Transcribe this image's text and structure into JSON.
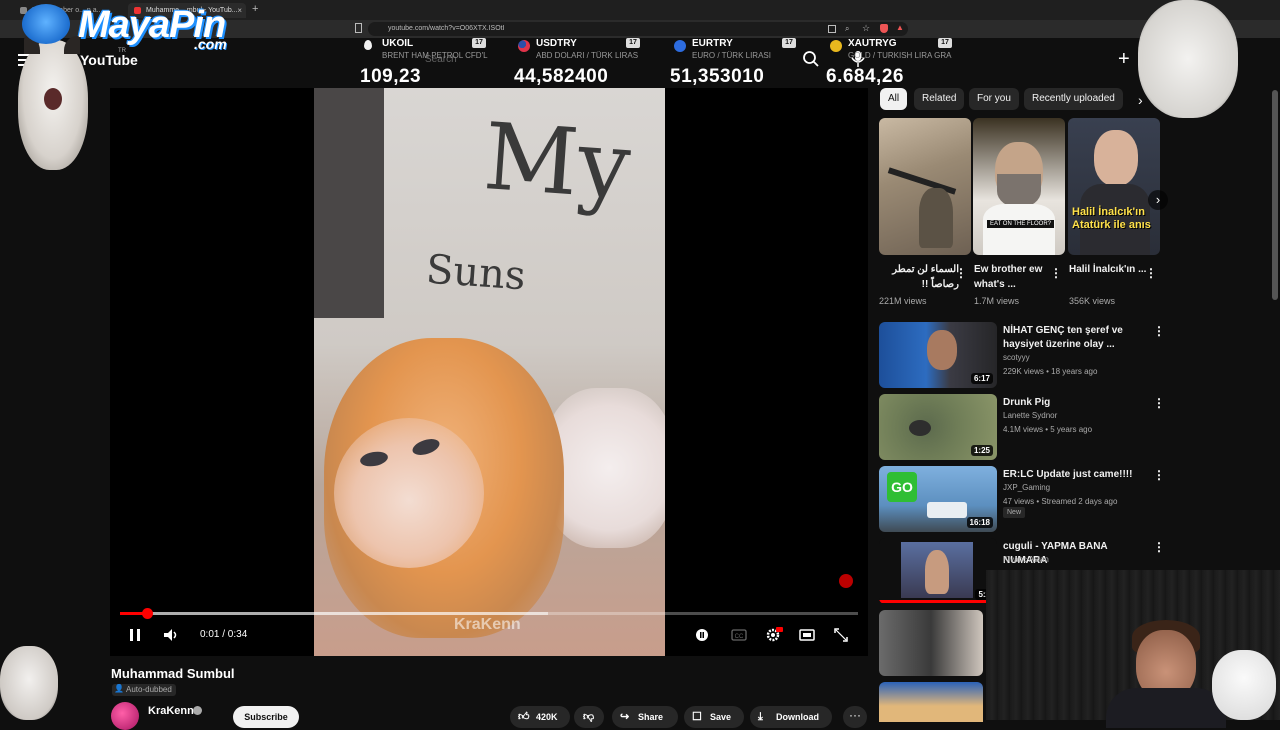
{
  "browser": {
    "tabs": [
      {
        "label": "Mu... 3 haber o... n a...",
        "active": false
      },
      {
        "label": "Muhamme... mbul - YouTub...",
        "active": true
      }
    ],
    "url": "youtube.com/watch?v=O06XTX.ISOtI"
  },
  "overlay_logo": {
    "text": "MayaPin",
    "sub": ".com"
  },
  "youtube": {
    "wordmark": "YouTube",
    "region": "TR",
    "search_placeholder": "Search"
  },
  "ticker": [
    {
      "symbol": "UKOIL",
      "desc": "BRENT HAM PETROL CFD'L",
      "value": "109,23",
      "color": "#f2f2f2"
    },
    {
      "symbol": "USDTRY",
      "desc": "ABD DOLARI / TÜRK LIRAS",
      "value": "44,582400",
      "color": "#e0334a"
    },
    {
      "symbol": "EURTRY",
      "desc": "EURO / TÜRK LIRASI",
      "value": "51,353010",
      "color": "#2d6cdf"
    },
    {
      "symbol": "XAUTRYG",
      "desc": "GOLD / TURKISH LIRA GRA",
      "value": "6.684,26",
      "color": "#e8b81e"
    }
  ],
  "player": {
    "shirt_text_1": "My",
    "shirt_text_2": "Suns",
    "watermark": "KraKenn",
    "time": "0:01 / 0:34",
    "progress_fraction": 0.037,
    "buffer_fraction": 0.58
  },
  "video": {
    "title": "Muhammad Sumbul",
    "auto_dubbed": "Auto-dubbed",
    "channel": "KraKenn",
    "subscribe": "Subscribe",
    "likes": "420K",
    "share": "Share",
    "save": "Save",
    "download": "Download"
  },
  "chips": [
    "All",
    "Related",
    "For you",
    "Recently uploaded"
  ],
  "shorts": [
    {
      "title": "السماء لن تمطر رصاصاً !!",
      "views": "221M views",
      "overlay": ""
    },
    {
      "title": "Ew brother ew what's ...",
      "views": "1.7M views",
      "overlay": "EAT ON THE FLOOR?"
    },
    {
      "title": "Halil İnalcık'ın ...",
      "views": "356K views",
      "overlay": "Halil İnalcık'ın Atatürk ile anıs"
    }
  ],
  "recommendations": [
    {
      "title": "NİHAT GENÇ ten şeref ve haysiyet üzerine olay ...",
      "channel": "scotyyy",
      "meta": "229K views • 18 years ago",
      "duration": "6:17",
      "badge": ""
    },
    {
      "title": "Drunk Pig",
      "channel": "Lanette Sydnor",
      "meta": "4.1M views • 5 years ago",
      "duration": "1:25",
      "badge": ""
    },
    {
      "title": "ER:LC Update just came!!!!",
      "channel": "JXP_Gaming",
      "meta": "47 views • Streamed 2 days ago",
      "duration": "16:18",
      "badge": "New"
    },
    {
      "title": "cuguli - YAPMA BANA NUMARA",
      "channel": "Kivanc Aslan",
      "meta": "",
      "duration": "5:2",
      "badge": ""
    }
  ],
  "colors": {
    "accent": "#ff0000",
    "background": "#0f0f0f",
    "chip": "#272727"
  }
}
